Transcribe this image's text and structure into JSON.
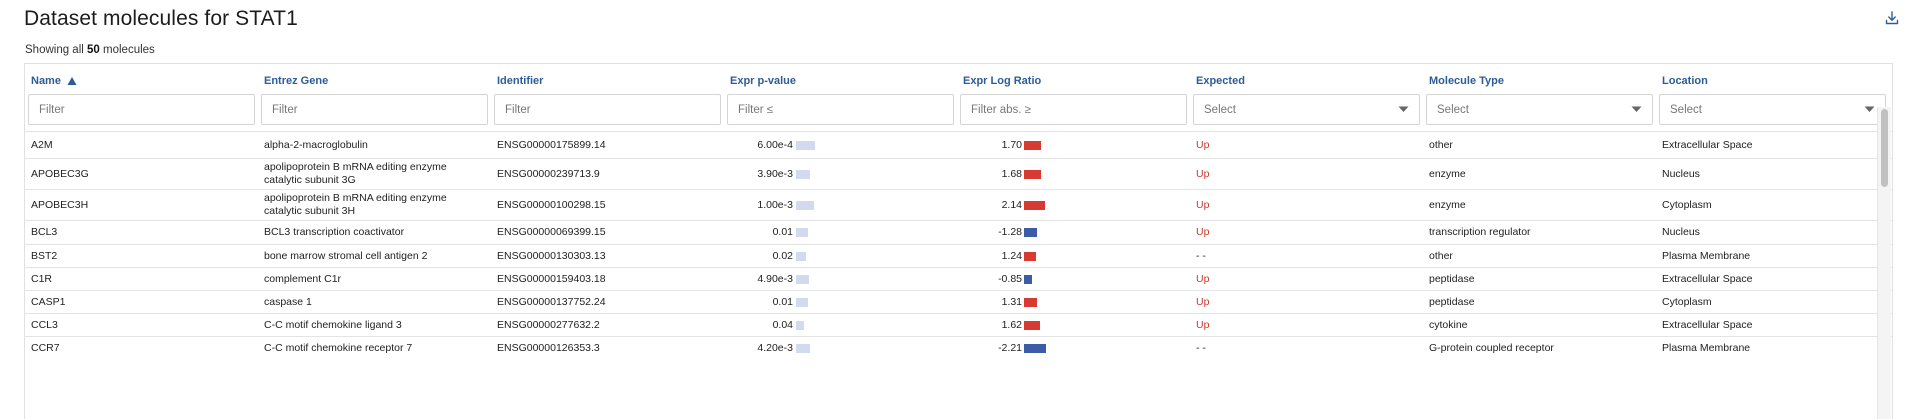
{
  "header": {
    "title": "Dataset molecules for STAT1",
    "showing_prefix": "Showing all",
    "showing_count": "50",
    "showing_suffix": "molecules"
  },
  "columns": [
    {
      "label": "Name"
    },
    {
      "label": "Entrez Gene"
    },
    {
      "label": "Identifier"
    },
    {
      "label": "Expr p-value"
    },
    {
      "label": "Expr Log Ratio"
    },
    {
      "label": "Expected"
    },
    {
      "label": "Molecule Type"
    },
    {
      "label": "Location"
    }
  ],
  "filters": [
    {
      "type": "text",
      "placeholder": "Filter"
    },
    {
      "type": "text",
      "placeholder": "Filter"
    },
    {
      "type": "text",
      "placeholder": "Filter"
    },
    {
      "type": "text",
      "placeholder": "Filter ≤"
    },
    {
      "type": "text",
      "placeholder": "Filter abs. ≥"
    },
    {
      "type": "select",
      "value": "Select"
    },
    {
      "type": "select",
      "value": "Select"
    },
    {
      "type": "select",
      "value": "Select"
    }
  ],
  "colors": {
    "accent": "#2d5c97",
    "up": "#c8392b",
    "bar_positive": "#d63a33",
    "bar_negative": "#3d5ca8",
    "pvalue_bar": "#d3d9ef"
  },
  "rows": [
    {
      "name": "A2M",
      "entrez": "alpha-2-macroglobulin",
      "identifier": "ENSG00000175899.14",
      "pvalue": "6.00e-4",
      "pvalue_bar_frac": 0.6,
      "logratio": "1.70",
      "logratio_value": 1.7,
      "expected": "Up",
      "type": "other",
      "location": "Extracellular Space"
    },
    {
      "name": "APOBEC3G",
      "entrez": "apolipoprotein B mRNA editing enzyme catalytic subunit 3G",
      "identifier": "ENSG00000239713.9",
      "pvalue": "3.90e-3",
      "pvalue_bar_frac": 0.45,
      "logratio": "1.68",
      "logratio_value": 1.68,
      "expected": "Up",
      "type": "enzyme",
      "location": "Nucleus"
    },
    {
      "name": "APOBEC3H",
      "entrez": "apolipoprotein B mRNA editing enzyme catalytic subunit 3H",
      "identifier": "ENSG00000100298.15",
      "pvalue": "1.00e-3",
      "pvalue_bar_frac": 0.55,
      "logratio": "2.14",
      "logratio_value": 2.14,
      "expected": "Up",
      "type": "enzyme",
      "location": "Cytoplasm"
    },
    {
      "name": "BCL3",
      "entrez": "BCL3 transcription coactivator",
      "identifier": "ENSG00000069399.15",
      "pvalue": "0.01",
      "pvalue_bar_frac": 0.36,
      "logratio": "-1.28",
      "logratio_value": -1.28,
      "expected": "Up",
      "type": "transcription regulator",
      "location": "Nucleus"
    },
    {
      "name": "BST2",
      "entrez": "bone marrow stromal cell antigen 2",
      "identifier": "ENSG00000130303.13",
      "pvalue": "0.02",
      "pvalue_bar_frac": 0.3,
      "logratio": "1.24",
      "logratio_value": 1.24,
      "expected": "- -",
      "type": "other",
      "location": "Plasma Membrane"
    },
    {
      "name": "C1R",
      "entrez": "complement C1r",
      "identifier": "ENSG00000159403.18",
      "pvalue": "4.90e-3",
      "pvalue_bar_frac": 0.42,
      "logratio": "-0.85",
      "logratio_value": -0.85,
      "expected": "Up",
      "type": "peptidase",
      "location": "Extracellular Space"
    },
    {
      "name": "CASP1",
      "entrez": "caspase 1",
      "identifier": "ENSG00000137752.24",
      "pvalue": "0.01",
      "pvalue_bar_frac": 0.36,
      "logratio": "1.31",
      "logratio_value": 1.31,
      "expected": "Up",
      "type": "peptidase",
      "location": "Cytoplasm"
    },
    {
      "name": "CCL3",
      "entrez": "C-C motif chemokine ligand 3",
      "identifier": "ENSG00000277632.2",
      "pvalue": "0.04",
      "pvalue_bar_frac": 0.24,
      "logratio": "1.62",
      "logratio_value": 1.62,
      "expected": "Up",
      "type": "cytokine",
      "location": "Extracellular Space"
    },
    {
      "name": "CCR7",
      "entrez": "C-C motif chemokine receptor 7",
      "identifier": "ENSG00000126353.3",
      "pvalue": "4.20e-3",
      "pvalue_bar_frac": 0.44,
      "logratio": "-2.21",
      "logratio_value": -2.21,
      "expected": "- -",
      "type": "G-protein coupled receptor",
      "location": "Plasma Membrane"
    }
  ]
}
